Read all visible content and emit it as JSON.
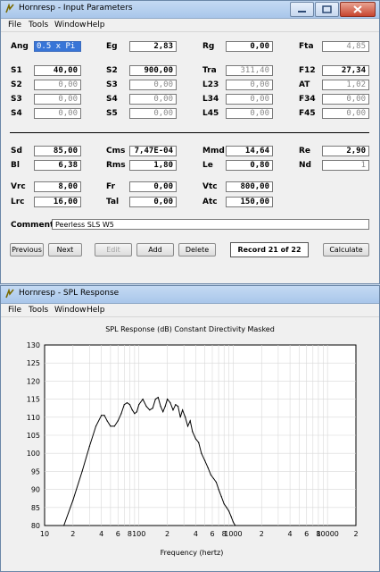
{
  "input_window": {
    "title": "Hornresp - Input Parameters",
    "menu": [
      "File",
      "Tools",
      "Window",
      "Help"
    ],
    "rows1": [
      [
        {
          "label": "Ang",
          "value": "0.5 x Pi",
          "style": "sel"
        },
        {
          "label": "Eg",
          "value": "2,83",
          "style": "bold"
        },
        {
          "label": "Rg",
          "value": "0,00",
          "style": "bold"
        },
        {
          "label": "Fta",
          "value": "4,85",
          "style": "gray"
        }
      ],
      [
        {
          "label": "S1",
          "value": "40,00",
          "style": "bold"
        },
        {
          "label": "S2",
          "value": "900,00",
          "style": "bold"
        },
        {
          "label": "Tra",
          "value": "311,40",
          "style": "gray"
        },
        {
          "label": "F12",
          "value": "27,34",
          "style": "bold"
        }
      ],
      [
        {
          "label": "S2",
          "value": "0,00",
          "style": "gray"
        },
        {
          "label": "S3",
          "value": "0,00",
          "style": "gray"
        },
        {
          "label": "L23",
          "value": "0,00",
          "style": "gray"
        },
        {
          "label": "AT",
          "value": "1,02",
          "style": "gray"
        }
      ],
      [
        {
          "label": "S3",
          "value": "0,00",
          "style": "gray"
        },
        {
          "label": "S4",
          "value": "0,00",
          "style": "gray"
        },
        {
          "label": "L34",
          "value": "0,00",
          "style": "gray"
        },
        {
          "label": "F34",
          "value": "0,00",
          "style": "gray"
        }
      ],
      [
        {
          "label": "S4",
          "value": "0,00",
          "style": "gray"
        },
        {
          "label": "S5",
          "value": "0,00",
          "style": "gray"
        },
        {
          "label": "L45",
          "value": "0,00",
          "style": "gray"
        },
        {
          "label": "F45",
          "value": "0,00",
          "style": "gray"
        }
      ]
    ],
    "rows2": [
      [
        {
          "label": "Sd",
          "value": "85,00",
          "style": "bold"
        },
        {
          "label": "Cms",
          "value": "7,47E-04",
          "style": "bold"
        },
        {
          "label": "Mmd",
          "value": "14,64",
          "style": "bold"
        },
        {
          "label": "Re",
          "value": "2,90",
          "style": "bold"
        }
      ],
      [
        {
          "label": "Bl",
          "value": "6,38",
          "style": "bold"
        },
        {
          "label": "Rms",
          "value": "1,80",
          "style": "bold"
        },
        {
          "label": "Le",
          "value": "0,80",
          "style": "bold"
        },
        {
          "label": "Nd",
          "value": "1",
          "style": "gray"
        }
      ],
      [
        {
          "label": "Vrc",
          "value": "8,00",
          "style": "bold"
        },
        {
          "label": "Fr",
          "value": "0,00",
          "style": "bold"
        },
        {
          "label": "Vtc",
          "value": "800,00",
          "style": "bold"
        }
      ],
      [
        {
          "label": "Lrc",
          "value": "16,00",
          "style": "bold"
        },
        {
          "label": "Tal",
          "value": "0,00",
          "style": "bold"
        },
        {
          "label": "Atc",
          "value": "150,00",
          "style": "bold"
        }
      ]
    ],
    "comment_label": "Comment",
    "comment_value": "Peerless SLS W5",
    "buttons": {
      "previous": "Previous",
      "next": "Next",
      "edit": "Edit",
      "add": "Add",
      "delete": "Delete",
      "calculate": "Calculate"
    },
    "record": "Record 21 of 22"
  },
  "spl_window": {
    "title": "Hornresp - SPL Response",
    "menu": [
      "File",
      "Tools",
      "Window",
      "Help"
    ]
  },
  "chart_data": {
    "type": "line",
    "title": "SPL Response (dB)   Constant Directivity   Masked",
    "xlabel": "Frequency (hertz)",
    "ylabel": "",
    "x_scale": "log",
    "xlim": [
      10,
      20000
    ],
    "ylim": [
      80,
      130
    ],
    "x_tick_labels": [
      {
        "v": 10,
        "t": "10"
      },
      {
        "v": 20,
        "t": "2"
      },
      {
        "v": 40,
        "t": "4"
      },
      {
        "v": 60,
        "t": "6"
      },
      {
        "v": 80,
        "t": "8"
      },
      {
        "v": 100,
        "t": "100"
      },
      {
        "v": 200,
        "t": "2"
      },
      {
        "v": 400,
        "t": "4"
      },
      {
        "v": 600,
        "t": "6"
      },
      {
        "v": 800,
        "t": "8"
      },
      {
        "v": 1000,
        "t": "1000"
      },
      {
        "v": 2000,
        "t": "2"
      },
      {
        "v": 4000,
        "t": "4"
      },
      {
        "v": 6000,
        "t": "6"
      },
      {
        "v": 8000,
        "t": "8"
      },
      {
        "v": 10000,
        "t": "10000"
      },
      {
        "v": 20000,
        "t": "2"
      }
    ],
    "y_ticks": [
      80,
      85,
      90,
      95,
      100,
      105,
      110,
      115,
      120,
      125,
      130
    ],
    "grid": true,
    "series": [
      {
        "x": [
          16,
          20,
          25,
          30,
          35,
          40,
          43,
          46,
          50,
          55,
          60,
          65,
          70,
          75,
          80,
          85,
          90,
          95,
          100,
          110,
          120,
          130,
          140,
          150,
          160,
          170,
          180,
          190,
          200,
          215,
          230,
          245,
          260,
          275,
          290,
          310,
          330,
          350,
          370,
          400,
          430,
          460,
          500,
          540,
          580,
          620,
          660,
          700,
          750,
          800,
          850,
          900,
          950,
          1000,
          1050
        ],
        "y": [
          80,
          87,
          95,
          102,
          107.5,
          110.5,
          110.5,
          109,
          107.5,
          107.5,
          109,
          111,
          113.5,
          114,
          113.5,
          112,
          111,
          111.5,
          113.5,
          115,
          113,
          112,
          112.5,
          115,
          115.5,
          113,
          111.5,
          113,
          115,
          114,
          112,
          113.5,
          113,
          110,
          112,
          110,
          107.5,
          109,
          106,
          104,
          103,
          100,
          98,
          96,
          94,
          93,
          92,
          90,
          88,
          86,
          85,
          84,
          82.5,
          81,
          80
        ]
      }
    ]
  }
}
